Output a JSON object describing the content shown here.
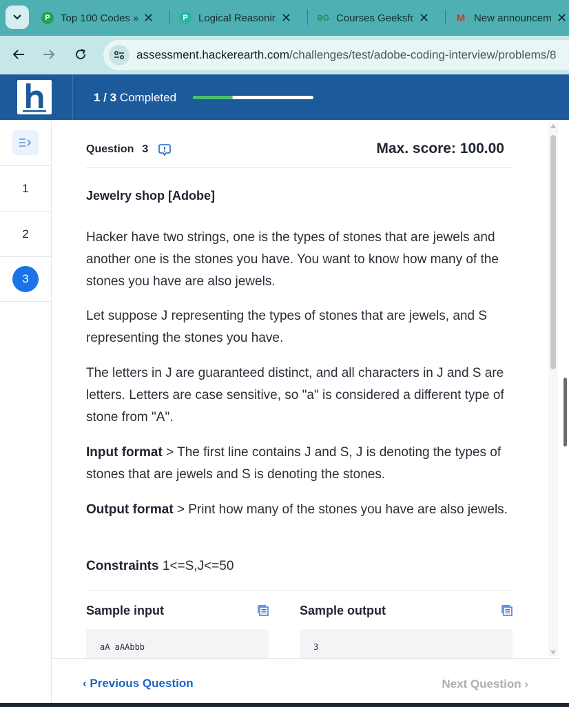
{
  "browser": {
    "tabs": [
      {
        "title": "Top 100 Codes »",
        "icon": "green-circle-icon",
        "color": "#22a352"
      },
      {
        "title": "Logical Reasoning",
        "icon": "p-logo-icon",
        "color": "#2bb5a0"
      },
      {
        "title": "Courses GeeksforGeeks",
        "icon": "gfg-logo-icon",
        "color": "#2f8d46"
      },
      {
        "title": "New announcement",
        "icon": "gmail-icon",
        "color": "#d93025"
      }
    ],
    "url_host": "assessment.hackerearth.com",
    "url_path": "/challenges/test/adobe-coding-interview/problems/8"
  },
  "header": {
    "progress_count": "1 / 3",
    "progress_word": "Completed",
    "progress_fraction": 0.33,
    "brand_color": "#1c5a9b",
    "accent_color": "#4ac06d"
  },
  "rail": {
    "items": [
      "1",
      "2",
      "3"
    ],
    "active_index": 2
  },
  "question": {
    "label": "Question",
    "number": "3",
    "max_score": "Max. score: 100.00",
    "title": "Jewelry shop [Adobe]",
    "paragraphs": [
      "Hacker have two strings, one is the types of stones that are jewels and another one is the stones you have. You want to know how many of the stones you have are also jewels.",
      "Let suppose J representing the types of stones that are jewels, and S representing the stones you have.",
      "The letters in J are guaranteed distinct, and all characters in J and S are letters. Letters are case sensitive, so \"a\" is considered a different type of stone from \"A\"."
    ],
    "input_format_label": "Input format",
    "input_format_text": " > The first line contains J and S, J is denoting the types of stones that are jewels and S is denoting the stones.",
    "output_format_label": "Output format",
    "output_format_text": " > Print how many of the stones you have are also jewels.",
    "constraints_label": "Constraints",
    "constraints_text": " 1<=S,J<=50"
  },
  "samples": {
    "input_label": "Sample input",
    "input_value": "aA aAAbbb",
    "output_label": "Sample output",
    "output_value": "3"
  },
  "footer": {
    "prev_label": "Previous Question",
    "next_label": "Next Question"
  }
}
